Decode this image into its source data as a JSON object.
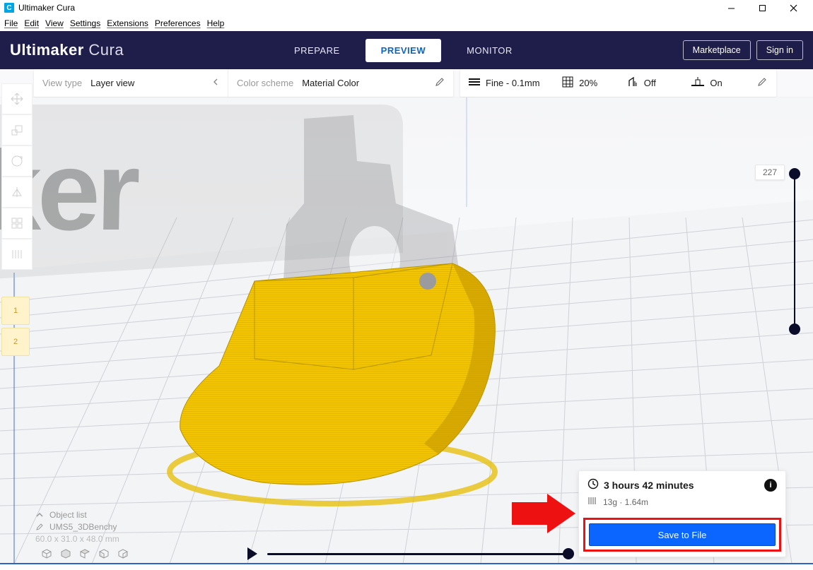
{
  "window": {
    "title": "Ultimaker Cura"
  },
  "menubar": [
    "File",
    "Edit",
    "View",
    "Settings",
    "Extensions",
    "Preferences",
    "Help"
  ],
  "logo": {
    "bold": "Ultimaker",
    "thin": "Cura"
  },
  "stages": {
    "prepare": "PREPARE",
    "preview": "PREVIEW",
    "monitor": "MONITOR"
  },
  "header_buttons": {
    "marketplace": "Marketplace",
    "signin": "Sign in"
  },
  "left_panel": {
    "view_type_label": "View type",
    "view_type_value": "Layer view",
    "color_scheme_label": "Color scheme",
    "color_scheme_value": "Material Color"
  },
  "print_settings": {
    "profile": "Fine - 0.1mm",
    "infill": "20%",
    "support": "Off",
    "adhesion": "On"
  },
  "layer_slider": {
    "top_value": "227"
  },
  "object_list": {
    "title": "Object list",
    "item": "UMS5_3DBenchy",
    "dims": "60.0 x 31.0 x 48.0 mm"
  },
  "output": {
    "time": "3 hours 42 minutes",
    "material": "13g · 1.64m",
    "save_label": "Save to File"
  },
  "extruder_tags": [
    "1",
    "2"
  ],
  "ghost_text": "ker"
}
